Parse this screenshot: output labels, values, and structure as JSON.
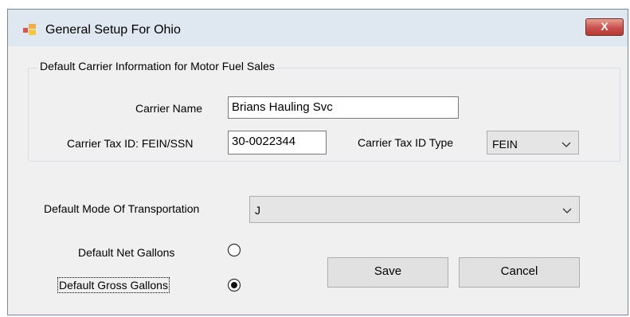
{
  "window": {
    "title": "General Setup For Ohio",
    "close_label": "X"
  },
  "carrier_group": {
    "legend": "Default Carrier Information for Motor Fuel Sales",
    "carrier_name_label": "Carrier Name",
    "carrier_name_value": "Brians Hauling Svc",
    "carrier_tax_id_label": "Carrier Tax ID: FEIN/SSN",
    "carrier_tax_id_value": "30-0022344",
    "carrier_tax_id_type_label": "Carrier Tax ID Type",
    "carrier_tax_id_type_value": "FEIN"
  },
  "transport": {
    "label": "Default Mode Of Transportation",
    "value": "J"
  },
  "gallons": {
    "net_label": "Default Net Gallons",
    "gross_label": "Default Gross Gallons",
    "selected": "gross"
  },
  "buttons": {
    "save": "Save",
    "cancel": "Cancel"
  },
  "colors": {
    "window_bg": "#f0f0f0",
    "titlebar_bg": "#dfe7f1",
    "close_button": "#c75050"
  },
  "icons": {
    "app": "window-app-icon",
    "close": "close-icon",
    "dropdown": "chevron-down-icon"
  }
}
